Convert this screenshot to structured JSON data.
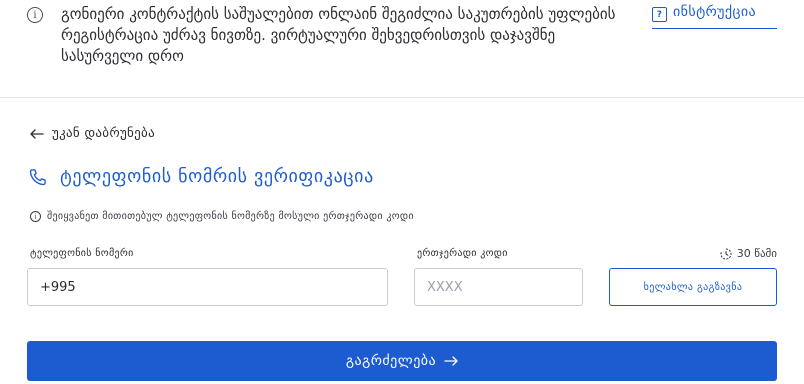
{
  "notice": {
    "icon": "info-circle-icon",
    "text": "გონიერი კონტრაქტის საშუალებით ონლაინ შეგიძლია საკუთრების უფლების რეგისტრაცია უძრავ ნივთზე. ვირტუალური შეხვედრისთვის დაჯავშნე სასურველი დრო",
    "instruction_label": "ინსტრუქცია",
    "instruction_icon": "question-mark-icon"
  },
  "back": {
    "label": "უკან დაბრუნება",
    "icon": "arrow-left-icon"
  },
  "section": {
    "title": "ტელეფონის ნომრის ვერიფიკაცია",
    "icon": "phone-icon"
  },
  "hint": {
    "text": "შეიყვანეთ მითითებულ ტელეფონის ნომერზე მოსული ერთჯერადი კოდი",
    "icon": "info-circle-icon"
  },
  "form": {
    "phone_label": "ტელეფონის ნომერი",
    "phone_value": "+995",
    "code_label": "ერთჯერადი კოდი",
    "code_placeholder": "XXXX",
    "timer_text": "30 წამი",
    "timer_icon": "timer-icon",
    "resend_label": "ხელახლა გაგზავნა"
  },
  "actions": {
    "continue_label": "გაგრძელება",
    "continue_icon": "arrow-right-icon"
  },
  "colors": {
    "accent": "#1d5bd1",
    "text": "#2b2d33",
    "border": "#c9ccd3"
  }
}
